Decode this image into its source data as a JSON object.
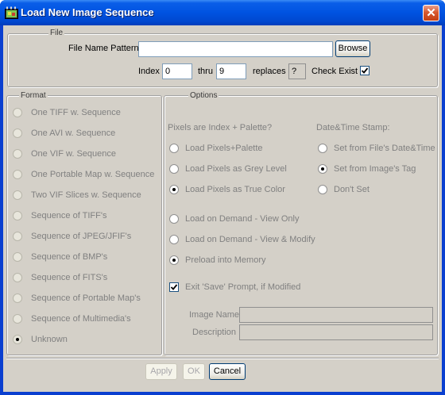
{
  "window": {
    "title": "Load New Image Sequence",
    "close_glyph": "✕"
  },
  "file_group": {
    "legend": "File",
    "pattern_label": "File Name Pattern",
    "pattern_value": "",
    "browse_label": "Browse",
    "index_label": "Index",
    "index_value": "0",
    "thru_label": "thru",
    "thru_value": "9",
    "replaces_label": "replaces",
    "replaces_value": "?",
    "check_exist_label": "Check Exist",
    "check_exist_checked": true
  },
  "format_group": {
    "legend": "Format",
    "items": [
      {
        "label": "One TIFF w. Sequence",
        "selected": false,
        "enabled": false
      },
      {
        "label": "One AVI w. Sequence",
        "selected": false,
        "enabled": false
      },
      {
        "label": "One VIF w. Sequence",
        "selected": false,
        "enabled": false
      },
      {
        "label": "One Portable Map w. Sequence",
        "selected": false,
        "enabled": false
      },
      {
        "label": "Two VIF Slices w. Sequence",
        "selected": false,
        "enabled": false
      },
      {
        "label": "Sequence of TIFF's",
        "selected": false,
        "enabled": false
      },
      {
        "label": "Sequence of JPEG/JFIF's",
        "selected": false,
        "enabled": false
      },
      {
        "label": "Sequence of BMP's",
        "selected": false,
        "enabled": false
      },
      {
        "label": "Sequence of FITS's",
        "selected": false,
        "enabled": false
      },
      {
        "label": "Sequence of Portable Map's",
        "selected": false,
        "enabled": false
      },
      {
        "label": "Sequence of Multimedia's",
        "selected": false,
        "enabled": false
      },
      {
        "label": "Unknown",
        "selected": true,
        "enabled": false
      }
    ]
  },
  "options_group": {
    "legend": "Options",
    "pixels_heading": "Pixels are Index + Palette?",
    "pixels_options": [
      {
        "label": "Load Pixels+Palette",
        "selected": false
      },
      {
        "label": "Load Pixels as Grey Level",
        "selected": false
      },
      {
        "label": "Load Pixels as True Color",
        "selected": true
      }
    ],
    "datetime_heading": "Date&Time Stamp:",
    "datetime_options": [
      {
        "label": "Set from File's Date&Time",
        "selected": false
      },
      {
        "label": "Set from Image's Tag",
        "selected": true
      },
      {
        "label": "Don't Set",
        "selected": false
      }
    ],
    "load_options": [
      {
        "label": "Load on Demand - View Only",
        "selected": false
      },
      {
        "label": "Load on Demand - View & Modify",
        "selected": false
      },
      {
        "label": "Preload into Memory",
        "selected": true
      }
    ],
    "exit_prompt_label": "Exit 'Save' Prompt, if Modified",
    "exit_prompt_checked": true,
    "image_name_label": "Image Name",
    "image_name_value": "",
    "description_label": "Description",
    "description_value": ""
  },
  "buttons": {
    "apply": "Apply",
    "ok": "OK",
    "cancel": "Cancel"
  }
}
